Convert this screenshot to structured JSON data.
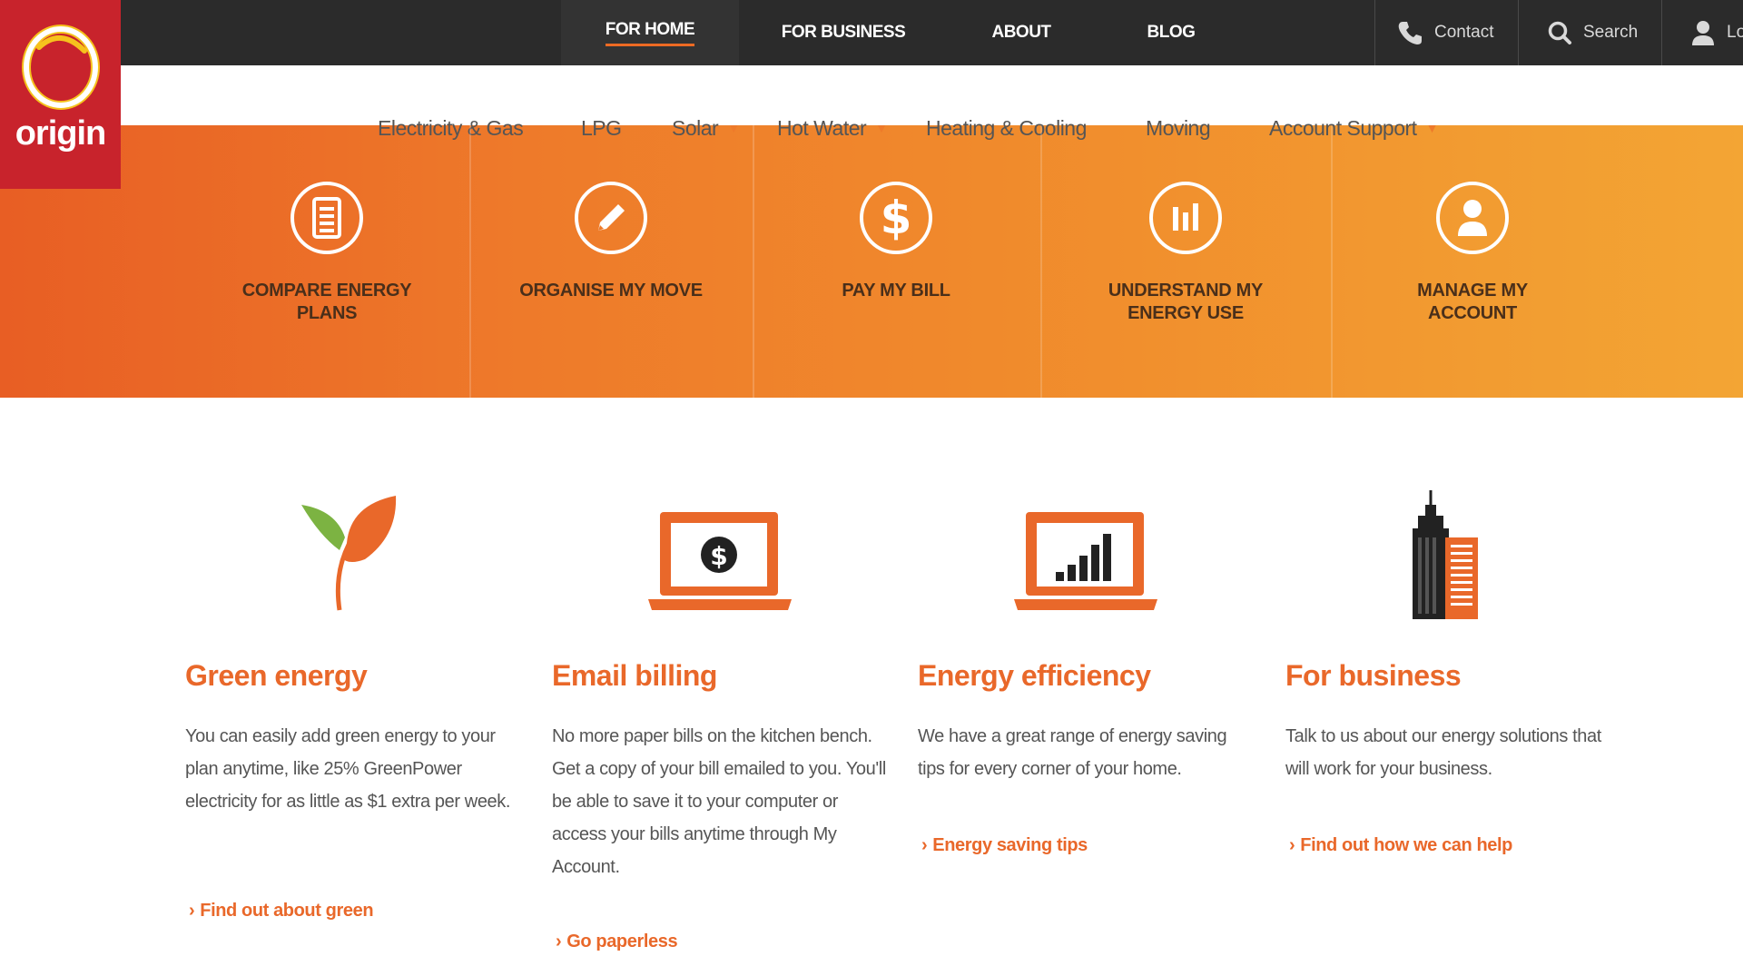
{
  "brand": {
    "logo_text": "origin",
    "primary": "#c8232c",
    "accent": "#ee6a23",
    "dark_bar": "#2b2b2b"
  },
  "top_nav": [
    {
      "label": "FOR HOME",
      "active": true
    },
    {
      "label": "FOR BUSINESS",
      "active": false
    },
    {
      "label": "ABOUT",
      "active": false
    },
    {
      "label": "BLOG",
      "active": false
    }
  ],
  "utility": {
    "contact_label": "Contact",
    "search_label": "Search",
    "login_label": "Lo",
    "icons": [
      "phone-icon",
      "search-icon",
      "user-icon"
    ]
  },
  "sub_nav": [
    {
      "label": "Electricity & Gas",
      "dropdown": true
    },
    {
      "label": "LPG",
      "dropdown": false
    },
    {
      "label": "Solar",
      "dropdown": true
    },
    {
      "label": "Hot Water",
      "dropdown": true
    },
    {
      "label": "Heating & Cooling",
      "dropdown": false
    },
    {
      "label": "Moving",
      "dropdown": false
    },
    {
      "label": "Account Support",
      "dropdown": true
    }
  ],
  "hero_tiles": [
    {
      "label": "COMPARE ENERGY PLANS",
      "icon": "document-list-icon"
    },
    {
      "label": "ORGANISE MY MOVE",
      "icon": "pencil-icon"
    },
    {
      "label": "PAY MY BILL",
      "icon": "dollar-icon"
    },
    {
      "label": "UNDERSTAND MY ENERGY USE",
      "icon": "bar-chart-icon"
    },
    {
      "label": "MANAGE MY ACCOUNT",
      "icon": "person-icon"
    }
  ],
  "features": [
    {
      "title": "Green energy",
      "text": "You can easily add green energy to your plan anytime, like 25% GreenPower electricity for as little as $1 extra per week.",
      "link": "Find out about green",
      "icon": "leaf-icon"
    },
    {
      "title": "Email billing",
      "text": "No more paper bills on the kitchen bench. Get a copy of your bill emailed to you. You'll be able to save it to your computer or access your bills anytime through My Account.",
      "link": "Go paperless",
      "icon": "laptop-dollar-icon"
    },
    {
      "title": "Energy efficiency",
      "text": "We have a great range of energy saving tips for every corner of your home.",
      "link": "Energy saving tips",
      "icon": "laptop-chart-icon"
    },
    {
      "title": "For business",
      "text": "Talk to us about our energy solutions that will work for your business.",
      "link": "Find out how we can help",
      "icon": "buildings-icon"
    }
  ]
}
